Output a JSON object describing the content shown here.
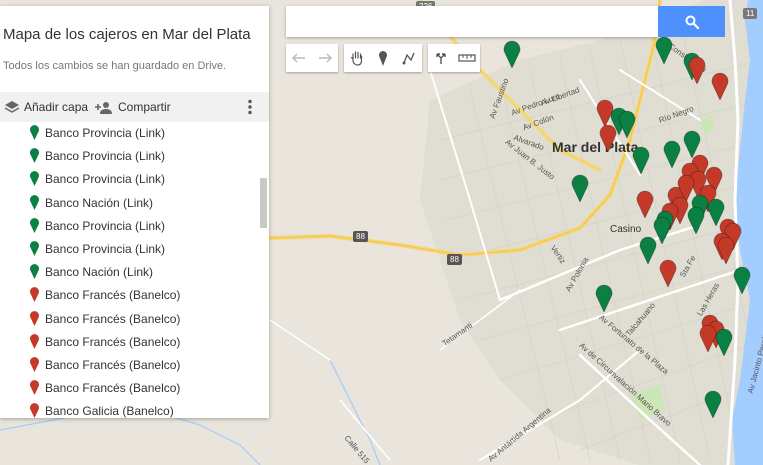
{
  "panel": {
    "title": "Mapa de los cajeros en Mar del Plata",
    "status": "Todos los cambios se han guardado en Drive.",
    "add_layer": "Añadir capa",
    "share": "Compartir",
    "items": [
      {
        "label": "Banco Provincia (Link)",
        "color": "#0b8043"
      },
      {
        "label": "Banco Provincia (Link)",
        "color": "#0b8043"
      },
      {
        "label": "Banco Provincia (Link)",
        "color": "#0b8043"
      },
      {
        "label": "Banco Nación (Link)",
        "color": "#0b8043"
      },
      {
        "label": "Banco Provincia (Link)",
        "color": "#0b8043"
      },
      {
        "label": "Banco Provincia (Link)",
        "color": "#0b8043"
      },
      {
        "label": "Banco Nación (Link)",
        "color": "#0b8043"
      },
      {
        "label": "Banco Francés (Banelco)",
        "color": "#c53929"
      },
      {
        "label": "Banco Francés (Banelco)",
        "color": "#c53929"
      },
      {
        "label": "Banco Francés (Banelco)",
        "color": "#c53929"
      },
      {
        "label": "Banco Francés (Banelco)",
        "color": "#c53929"
      },
      {
        "label": "Banco Francés (Banelco)",
        "color": "#c53929"
      },
      {
        "label": "Banco Galicia (Banelco)",
        "color": "#c53929"
      }
    ]
  },
  "search": {
    "value": "",
    "placeholder": ""
  },
  "colors": {
    "green_marker": "#0b8043",
    "red_marker": "#c53929",
    "search_button": "#4d90fe"
  },
  "map": {
    "city_label": "Mar del Plata",
    "place_labels": {
      "casino": "Casino",
      "route_88_a": "88",
      "route_88_b": "88",
      "route_11": "11",
      "route_226": "226"
    },
    "street_labels": {
      "constitucion": "Av Constitución",
      "libertad": "Av Libertad",
      "pedro_luro": "Av Pedro Luro",
      "colon": "Av Colón",
      "juan_b_justo": "Av Juan B. Justo",
      "alvarado": "Alvarado",
      "faustino": "Av Faustino",
      "rio_negro": "Río Negro",
      "vertiz": "Vertiz",
      "polonia": "Av Polonia",
      "tetamanti": "Tetamanti",
      "fortunato": "Av Fortunato de la Plaza",
      "circunvalacion": "Av de Circunvalación Mario Bravo",
      "antartida": "Av Antártida Argentina",
      "calle515": "Calle 515",
      "talcahuano": "Talcahuano",
      "santa_fe": "Sta Fe",
      "las_heras": "Las Heras",
      "carrasco": "Av Jacinto Peralta Ramos"
    }
  }
}
